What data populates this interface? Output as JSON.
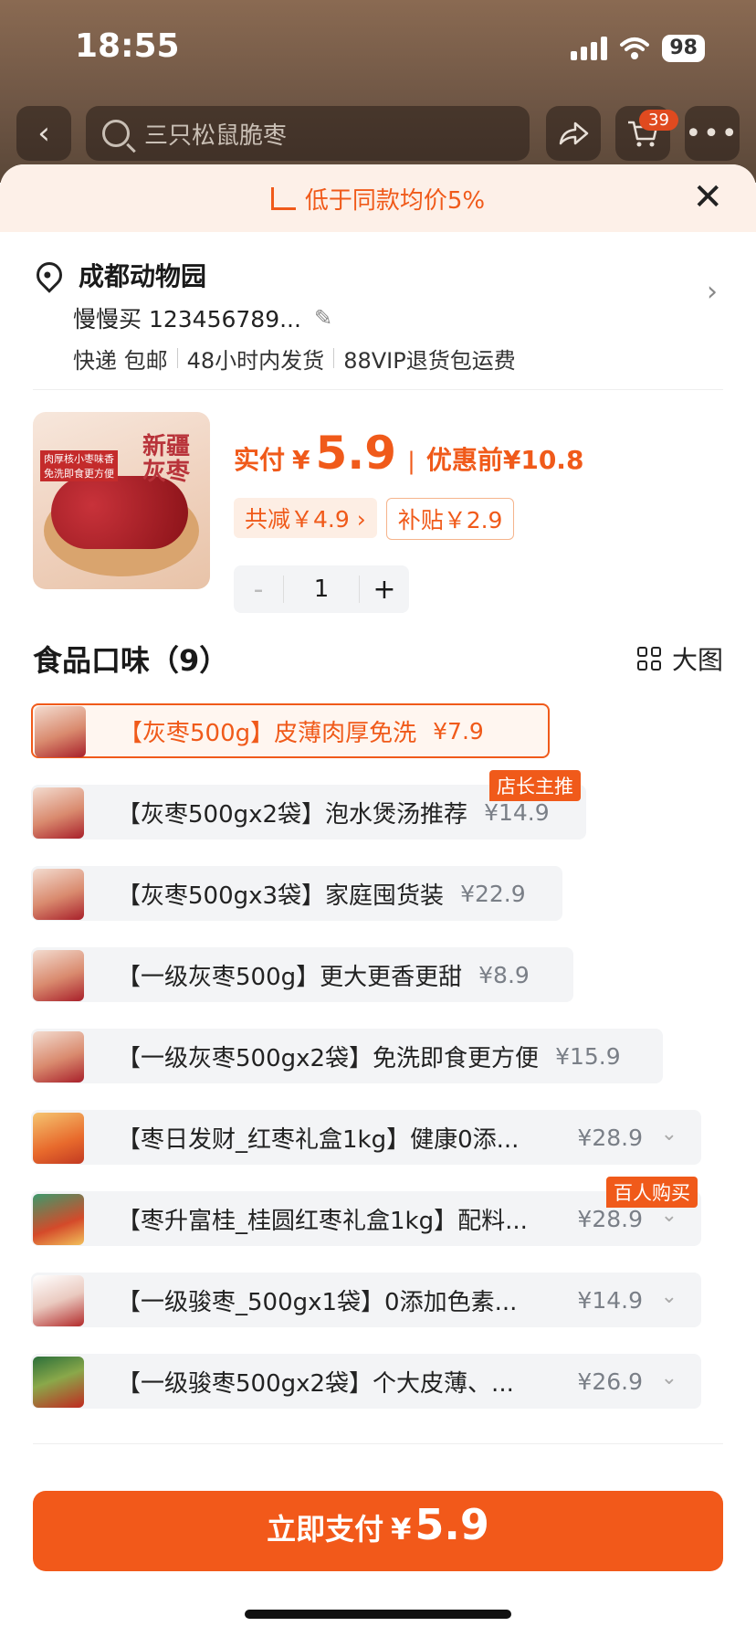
{
  "status": {
    "time": "18:55",
    "battery": "98"
  },
  "nav": {
    "search_text": "三只松鼠脆枣",
    "cart_count": "39"
  },
  "promo": {
    "text": "低于同款均价5%"
  },
  "address": {
    "name": "成都动物园",
    "contact": "慢慢买 123456789...",
    "shipping": "快递 包邮",
    "dispatch": "48小时内发货",
    "vip": "88VIP退货包运费"
  },
  "product": {
    "pay_label": "实付",
    "currency": "¥",
    "pay_price": "5.9",
    "before_label": "优惠前",
    "before_price": "¥10.8",
    "discount_chip": "共减￥4.9 ›",
    "subsidy_chip": "补贴￥2.9",
    "qty_minus": "-",
    "qty": "1",
    "qty_plus": "+",
    "thumb_title": "新疆灰枣",
    "thumb_tag1": "肉厚核小枣味香",
    "thumb_tag2": "免洗即食更方便"
  },
  "flavor": {
    "title": "食品口味（9）",
    "big_view": "大图",
    "options": [
      {
        "label": "【灰枣500g】皮薄肉厚免洗",
        "price": "¥7.9",
        "selected": true
      },
      {
        "label": "【灰枣500gx2袋】泡水煲汤推荐",
        "price": "¥14.9",
        "tag": "店长主推"
      },
      {
        "label": "【灰枣500gx3袋】家庭囤货装",
        "price": "¥22.9"
      },
      {
        "label": "【一级灰枣500g】更大更香更甜",
        "price": "¥8.9"
      },
      {
        "label": "【一级灰枣500gx2袋】免洗即食更方便",
        "price": "¥15.9"
      },
      {
        "label": "【枣日发财_红枣礼盒1kg】健康0添...",
        "price": "¥28.9"
      },
      {
        "label": "【枣升富桂_桂圆红枣礼盒1kg】配料...",
        "price": "¥28.9",
        "tag": "百人购买"
      },
      {
        "label": "【一级骏枣_500gx1袋】0添加色素...",
        "price": "¥14.9"
      },
      {
        "label": "【一级骏枣500gx2袋】个大皮薄、...",
        "price": "¥26.9"
      }
    ]
  },
  "pay_button": {
    "label": "立即支付",
    "currency": "¥",
    "amount": "5.9"
  },
  "colors": {
    "accent": "#f05a1a",
    "promo_bg": "#fdf0e8",
    "option_bg": "#f3f4f6"
  }
}
